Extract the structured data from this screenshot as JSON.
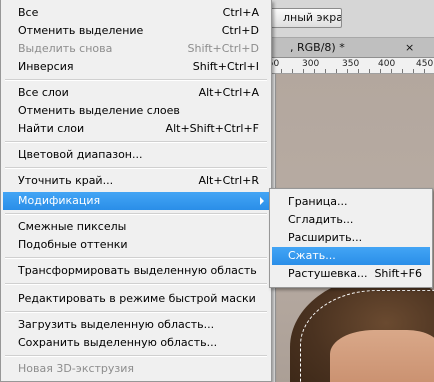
{
  "background": {
    "fullscreen_label": "лный экран",
    "doc_tab_title": ", RGB/8) *",
    "doc_tab_close": "×",
    "ruler_ticks": [
      "250",
      "300",
      "350",
      "400",
      "450"
    ]
  },
  "menu": {
    "items": [
      {
        "label": "Все",
        "shortcut": "Ctrl+A",
        "disabled": false
      },
      {
        "label": "Отменить выделение",
        "shortcut": "Ctrl+D",
        "disabled": false
      },
      {
        "label": "Выделить снова",
        "shortcut": "Shift+Ctrl+D",
        "disabled": true
      },
      {
        "label": "Инверсия",
        "shortcut": "Shift+Ctrl+I",
        "disabled": false
      },
      {
        "label": "Все слои",
        "shortcut": "Alt+Ctrl+A",
        "disabled": false
      },
      {
        "label": "Отменить выделение слоев",
        "shortcut": "",
        "disabled": false
      },
      {
        "label": "Найти слои",
        "shortcut": "Alt+Shift+Ctrl+F",
        "disabled": false
      },
      {
        "label": "Цветовой диапазон...",
        "shortcut": "",
        "disabled": false
      },
      {
        "label": "Уточнить край...",
        "shortcut": "Alt+Ctrl+R",
        "disabled": false
      },
      {
        "label": "Модификация",
        "shortcut": "",
        "disabled": false,
        "submenu": true
      },
      {
        "label": "Смежные пикселы",
        "shortcut": "",
        "disabled": false
      },
      {
        "label": "Подобные оттенки",
        "shortcut": "",
        "disabled": false
      },
      {
        "label": "Трансформировать выделенную область",
        "shortcut": "",
        "disabled": false
      },
      {
        "label": "Редактировать в режиме быстрой маски",
        "shortcut": "",
        "disabled": false
      },
      {
        "label": "Загрузить выделенную область...",
        "shortcut": "",
        "disabled": false
      },
      {
        "label": "Сохранить выделенную область...",
        "shortcut": "",
        "disabled": false
      },
      {
        "label": "Новая 3D-экструзия",
        "shortcut": "",
        "disabled": true
      }
    ]
  },
  "submenu": {
    "items": [
      {
        "label": "Граница...",
        "shortcut": ""
      },
      {
        "label": "Сгладить...",
        "shortcut": ""
      },
      {
        "label": "Расширить...",
        "shortcut": ""
      },
      {
        "label": "Сжать...",
        "shortcut": ""
      },
      {
        "label": "Растушевка...",
        "shortcut": "Shift+F6"
      }
    ]
  },
  "colors": {
    "highlight": "#3399ff",
    "menu_bg": "#f0f0f0",
    "disabled_text": "#8d8d8d"
  }
}
